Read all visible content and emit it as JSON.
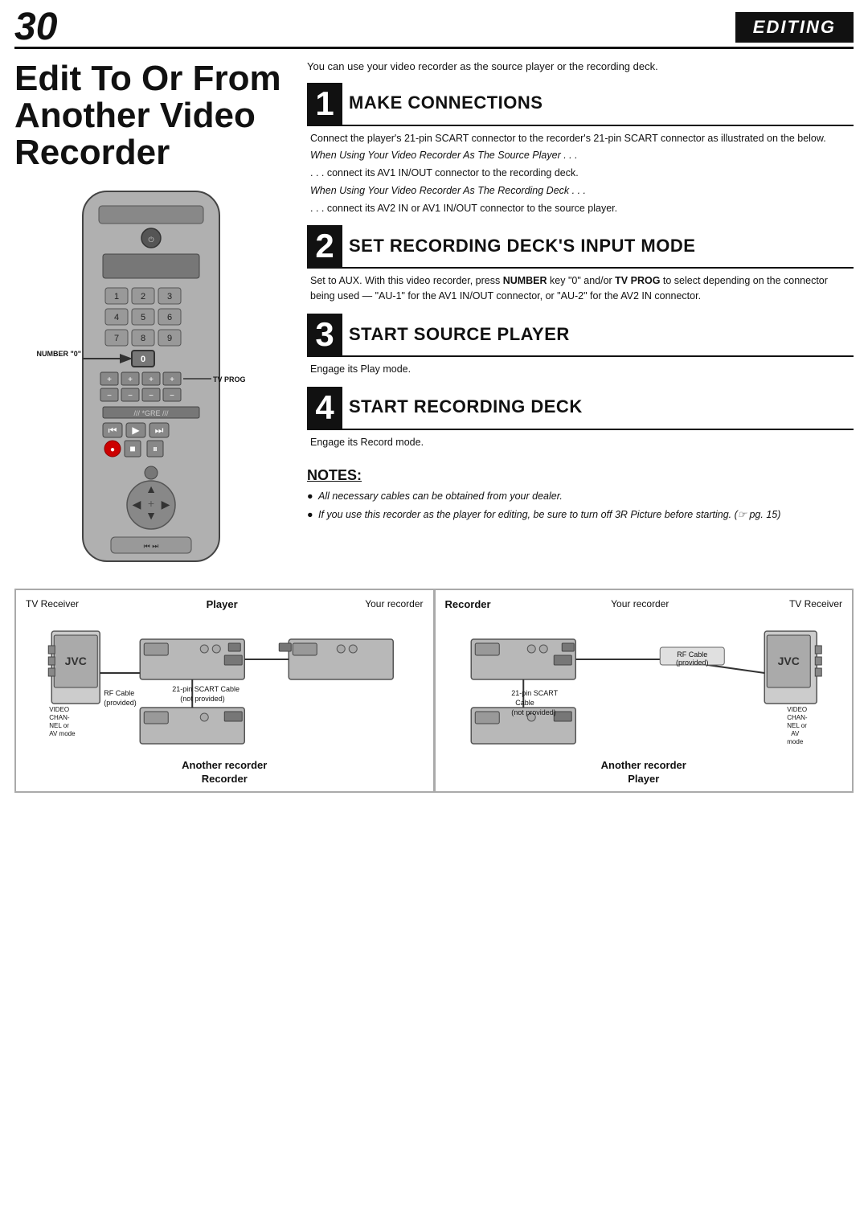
{
  "header": {
    "page_number": "30",
    "section": "EDITING"
  },
  "title": "Edit To Or From Another Video Recorder",
  "intro": "You can use your video recorder as the source player or the recording deck.",
  "steps": [
    {
      "number": "1",
      "title": "MAKE CONNECTIONS",
      "body": "Connect the player's 21-pin SCART connector to the recorder's 21-pin SCART connector as illustrated on the below.",
      "notes": [
        {
          "label": "When Using Your Video Recorder As The Source Player . . .",
          "text": ". . . connect its AV1 IN/OUT connector to the recording deck."
        },
        {
          "label": "When Using Your Video Recorder As The Recording Deck . . .",
          "text": ". . . connect its AV2 IN or AV1 IN/OUT connector to the source player."
        }
      ]
    },
    {
      "number": "2",
      "title": "SET RECORDING DECK'S INPUT MODE",
      "body": "Set to AUX. With this video recorder, press NUMBER key \"0\" and/or TV PROG to select depending on the connector being used — \"AU-1\" for the AV1 IN/OUT connector, or \"AU-2\" for the AV2 IN connector."
    },
    {
      "number": "3",
      "title": "START SOURCE PLAYER",
      "body": "Engage its Play mode."
    },
    {
      "number": "4",
      "title": "START RECORDING DECK",
      "body": "Engage its Record mode."
    }
  ],
  "notes_title": "NOTES:",
  "notes": [
    "All necessary cables can be obtained from your dealer.",
    "If you use this recorder as the player for editing, be sure to turn off 3R Picture before starting. (☞ pg. 15)"
  ],
  "remote": {
    "number_label": "NUMBER \"0\"",
    "tv_prog_label": "TV PROG"
  },
  "diagrams": [
    {
      "top_left": "TV Receiver",
      "top_center_bold": "Player",
      "top_right": "Your recorder",
      "cable_label1": "21-pin SCART Cable (not provided)",
      "cable_label2": "RF Cable (provided)",
      "side_label": "VIDEO CHAN- NEL or AV mode",
      "bottom_label": "Another recorder",
      "bottom_bold": "Recorder"
    },
    {
      "top_left_bold": "Recorder",
      "top_center": "Your recorder",
      "top_right": "TV Receiver",
      "cable_label1": "21-pin SCART Cable (not provided)",
      "cable_label2": "RF Cable (provided)",
      "side_label": "VIDEO CHAN- NEL or AV mode",
      "bottom_label": "Another recorder",
      "bottom_bold": "Player"
    }
  ]
}
